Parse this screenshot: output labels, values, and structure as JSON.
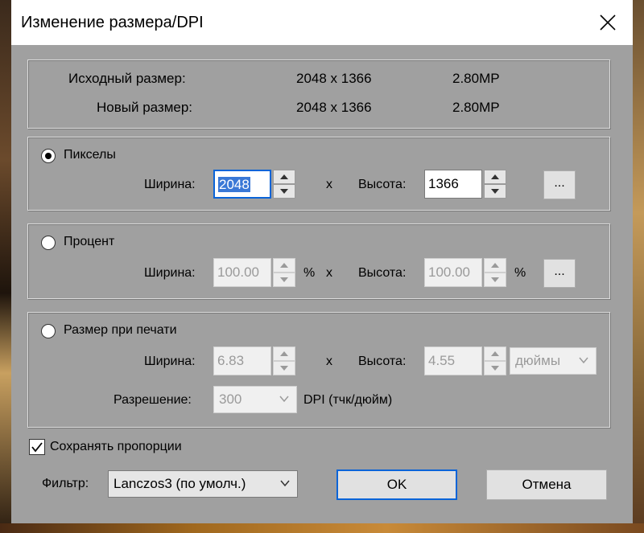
{
  "window": {
    "title": "Изменение размера/DPI"
  },
  "info": {
    "original_label": "Исходный размер:",
    "original_size": "2048 x 1366",
    "original_mp": "2.80MP",
    "new_label": "Новый размер:",
    "new_size": "2048 x 1366",
    "new_mp": "2.80MP"
  },
  "pixels": {
    "radio_label": "Пикселы",
    "selected": true,
    "width_label": "Ширина:",
    "width_value": "2048",
    "x": "x",
    "height_label": "Высота:",
    "height_value": "1366",
    "ellipsis": "..."
  },
  "percent": {
    "radio_label": "Процент",
    "selected": false,
    "width_label": "Ширина:",
    "width_value": "100.00",
    "pct": "%",
    "x": "x",
    "height_label": "Высота:",
    "height_value": "100.00",
    "pct2": "%",
    "ellipsis": "..."
  },
  "print": {
    "radio_label": "Размер при печати",
    "selected": false,
    "width_label": "Ширина:",
    "width_value": "6.83",
    "x": "x",
    "height_label": "Высота:",
    "height_value": "4.55",
    "unit": "дюймы",
    "resolution_label": "Разрешение:",
    "resolution_value": "300",
    "resolution_unit": "DPI (тчк/дюйм)"
  },
  "keep_proportions": {
    "label": "Сохранять пропорции",
    "checked": true
  },
  "filter": {
    "label": "Фильтр:",
    "value": "Lanczos3 (по умолч.)"
  },
  "buttons": {
    "ok": "OK",
    "cancel": "Отмена"
  },
  "colors": {
    "dialog_bg": "#a0a0a0",
    "accent": "#0a64d8",
    "selection": "#3a78d6"
  }
}
